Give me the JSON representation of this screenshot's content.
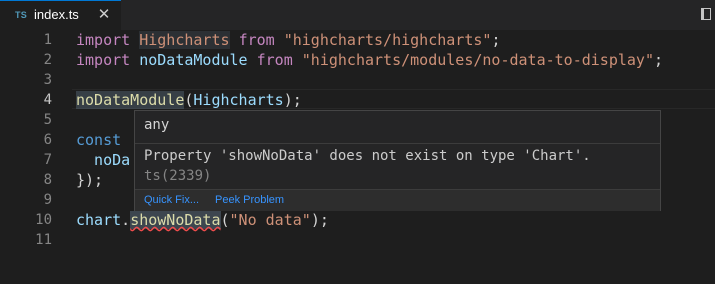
{
  "tab": {
    "icon": "TS",
    "filename": "index.ts",
    "close": "✕"
  },
  "lines": {
    "n1": "1",
    "n2": "2",
    "n3": "3",
    "n4": "4",
    "n5": "5",
    "n6": "6",
    "n7": "7",
    "n8": "8",
    "n9": "9",
    "n10": "10",
    "n11": "11",
    "l1": {
      "kw": "import",
      "name": "Highcharts",
      "from": "from",
      "src": "\"highcharts/highcharts\"",
      "end": ";"
    },
    "l2": {
      "kw": "import",
      "name": "noDataModule",
      "from": "from",
      "src": "\"highcharts/modules/no-data-to-display\"",
      "end": ";"
    },
    "l4": {
      "fn": "noDataModule",
      "open": "(",
      "arg": "Highcharts",
      "close": ");"
    },
    "l6": {
      "kw": "const"
    },
    "l7": {
      "text": "  noDa"
    },
    "l8": {
      "text": "});"
    },
    "l10": {
      "obj": "chart",
      "dot": ".",
      "method": "showNoData",
      "open": "(",
      "arg": "\"No data\"",
      "close": ");"
    }
  },
  "hover": {
    "type": "any",
    "message_main": "Property 'showNoData' does not exist on type 'Chart'.",
    "message_code": " ts(2339)",
    "quick_fix": "Quick Fix...",
    "peek_problem": "Peek Problem"
  }
}
